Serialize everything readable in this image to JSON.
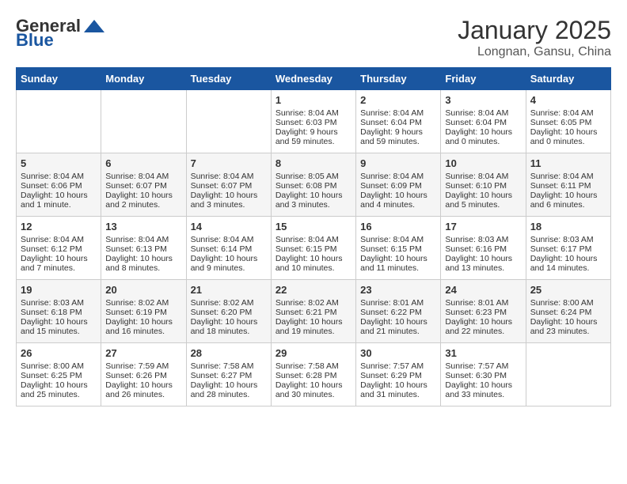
{
  "header": {
    "logo_general": "General",
    "logo_blue": "Blue",
    "title": "January 2025",
    "subtitle": "Longnan, Gansu, China"
  },
  "days_of_week": [
    "Sunday",
    "Monday",
    "Tuesday",
    "Wednesday",
    "Thursday",
    "Friday",
    "Saturday"
  ],
  "weeks": [
    {
      "days": [
        {
          "num": "",
          "empty": true
        },
        {
          "num": "",
          "empty": true
        },
        {
          "num": "",
          "empty": true
        },
        {
          "num": "1",
          "sunrise": "8:04 AM",
          "sunset": "6:03 PM",
          "daylight": "9 hours and 59 minutes."
        },
        {
          "num": "2",
          "sunrise": "8:04 AM",
          "sunset": "6:04 PM",
          "daylight": "9 hours and 59 minutes."
        },
        {
          "num": "3",
          "sunrise": "8:04 AM",
          "sunset": "6:04 PM",
          "daylight": "10 hours and 0 minutes."
        },
        {
          "num": "4",
          "sunrise": "8:04 AM",
          "sunset": "6:05 PM",
          "daylight": "10 hours and 0 minutes."
        }
      ]
    },
    {
      "days": [
        {
          "num": "5",
          "sunrise": "8:04 AM",
          "sunset": "6:06 PM",
          "daylight": "10 hours and 1 minute."
        },
        {
          "num": "6",
          "sunrise": "8:04 AM",
          "sunset": "6:07 PM",
          "daylight": "10 hours and 2 minutes."
        },
        {
          "num": "7",
          "sunrise": "8:04 AM",
          "sunset": "6:07 PM",
          "daylight": "10 hours and 3 minutes."
        },
        {
          "num": "8",
          "sunrise": "8:05 AM",
          "sunset": "6:08 PM",
          "daylight": "10 hours and 3 minutes."
        },
        {
          "num": "9",
          "sunrise": "8:04 AM",
          "sunset": "6:09 PM",
          "daylight": "10 hours and 4 minutes."
        },
        {
          "num": "10",
          "sunrise": "8:04 AM",
          "sunset": "6:10 PM",
          "daylight": "10 hours and 5 minutes."
        },
        {
          "num": "11",
          "sunrise": "8:04 AM",
          "sunset": "6:11 PM",
          "daylight": "10 hours and 6 minutes."
        }
      ]
    },
    {
      "days": [
        {
          "num": "12",
          "sunrise": "8:04 AM",
          "sunset": "6:12 PM",
          "daylight": "10 hours and 7 minutes."
        },
        {
          "num": "13",
          "sunrise": "8:04 AM",
          "sunset": "6:13 PM",
          "daylight": "10 hours and 8 minutes."
        },
        {
          "num": "14",
          "sunrise": "8:04 AM",
          "sunset": "6:14 PM",
          "daylight": "10 hours and 9 minutes."
        },
        {
          "num": "15",
          "sunrise": "8:04 AM",
          "sunset": "6:15 PM",
          "daylight": "10 hours and 10 minutes."
        },
        {
          "num": "16",
          "sunrise": "8:04 AM",
          "sunset": "6:15 PM",
          "daylight": "10 hours and 11 minutes."
        },
        {
          "num": "17",
          "sunrise": "8:03 AM",
          "sunset": "6:16 PM",
          "daylight": "10 hours and 13 minutes."
        },
        {
          "num": "18",
          "sunrise": "8:03 AM",
          "sunset": "6:17 PM",
          "daylight": "10 hours and 14 minutes."
        }
      ]
    },
    {
      "days": [
        {
          "num": "19",
          "sunrise": "8:03 AM",
          "sunset": "6:18 PM",
          "daylight": "10 hours and 15 minutes."
        },
        {
          "num": "20",
          "sunrise": "8:02 AM",
          "sunset": "6:19 PM",
          "daylight": "10 hours and 16 minutes."
        },
        {
          "num": "21",
          "sunrise": "8:02 AM",
          "sunset": "6:20 PM",
          "daylight": "10 hours and 18 minutes."
        },
        {
          "num": "22",
          "sunrise": "8:02 AM",
          "sunset": "6:21 PM",
          "daylight": "10 hours and 19 minutes."
        },
        {
          "num": "23",
          "sunrise": "8:01 AM",
          "sunset": "6:22 PM",
          "daylight": "10 hours and 21 minutes."
        },
        {
          "num": "24",
          "sunrise": "8:01 AM",
          "sunset": "6:23 PM",
          "daylight": "10 hours and 22 minutes."
        },
        {
          "num": "25",
          "sunrise": "8:00 AM",
          "sunset": "6:24 PM",
          "daylight": "10 hours and 23 minutes."
        }
      ]
    },
    {
      "days": [
        {
          "num": "26",
          "sunrise": "8:00 AM",
          "sunset": "6:25 PM",
          "daylight": "10 hours and 25 minutes."
        },
        {
          "num": "27",
          "sunrise": "7:59 AM",
          "sunset": "6:26 PM",
          "daylight": "10 hours and 26 minutes."
        },
        {
          "num": "28",
          "sunrise": "7:58 AM",
          "sunset": "6:27 PM",
          "daylight": "10 hours and 28 minutes."
        },
        {
          "num": "29",
          "sunrise": "7:58 AM",
          "sunset": "6:28 PM",
          "daylight": "10 hours and 30 minutes."
        },
        {
          "num": "30",
          "sunrise": "7:57 AM",
          "sunset": "6:29 PM",
          "daylight": "10 hours and 31 minutes."
        },
        {
          "num": "31",
          "sunrise": "7:57 AM",
          "sunset": "6:30 PM",
          "daylight": "10 hours and 33 minutes."
        },
        {
          "num": "",
          "empty": true
        }
      ]
    }
  ],
  "labels": {
    "sunrise_prefix": "Sunrise: ",
    "sunset_prefix": "Sunset: ",
    "daylight_prefix": "Daylight: "
  }
}
